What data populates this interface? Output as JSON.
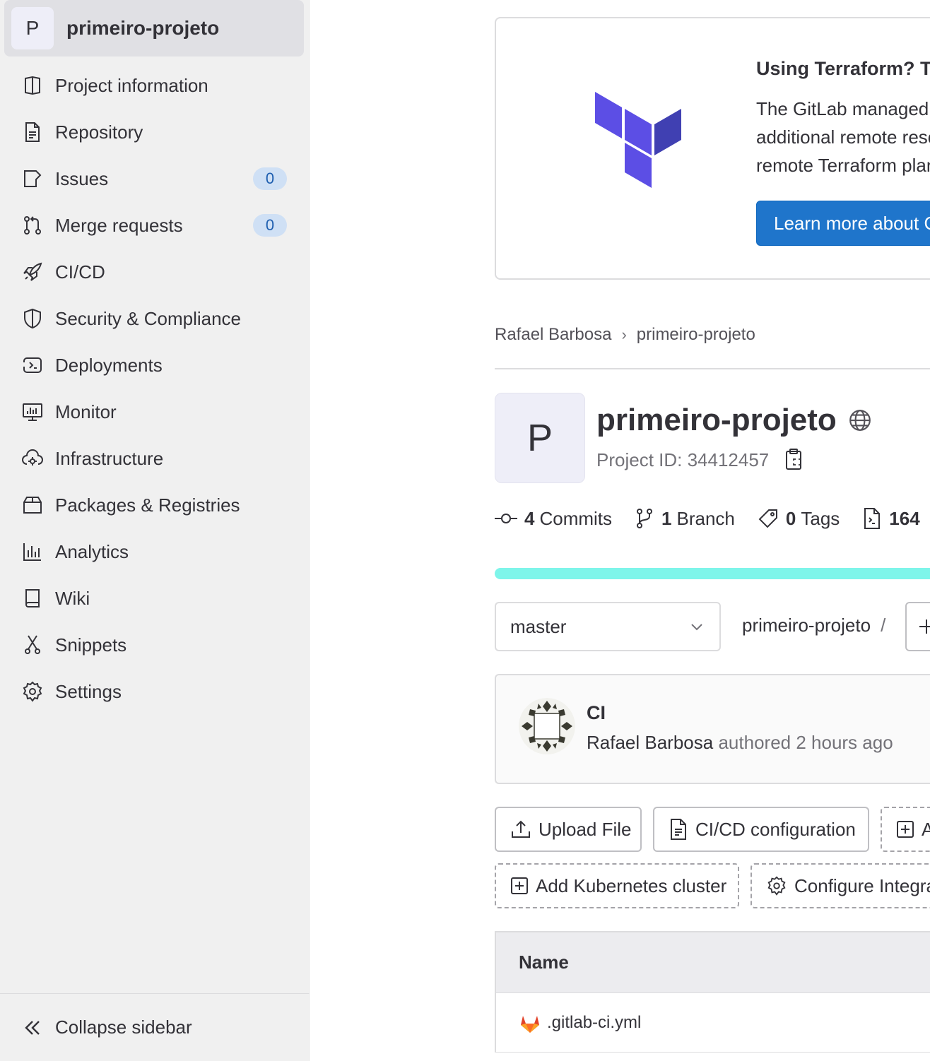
{
  "sidebar": {
    "project": {
      "avatar_letter": "P",
      "name": "primeiro-projeto"
    },
    "items": [
      {
        "label": "Project information",
        "icon": "project-icon"
      },
      {
        "label": "Repository",
        "icon": "doc-text-icon"
      },
      {
        "label": "Issues",
        "icon": "issues-icon",
        "badge": "0"
      },
      {
        "label": "Merge requests",
        "icon": "merge-request-icon",
        "badge": "0"
      },
      {
        "label": "CI/CD",
        "icon": "rocket-icon"
      },
      {
        "label": "Security & Compliance",
        "icon": "shield-icon"
      },
      {
        "label": "Deployments",
        "icon": "deployments-icon"
      },
      {
        "label": "Monitor",
        "icon": "monitor-icon"
      },
      {
        "label": "Infrastructure",
        "icon": "cloud-gear-icon"
      },
      {
        "label": "Packages & Registries",
        "icon": "package-icon"
      },
      {
        "label": "Analytics",
        "icon": "chart-icon"
      },
      {
        "label": "Wiki",
        "icon": "book-icon"
      },
      {
        "label": "Snippets",
        "icon": "scissors-icon"
      },
      {
        "label": "Settings",
        "icon": "settings-icon"
      }
    ],
    "collapse_label": "Collapse sidebar"
  },
  "terraform_banner": {
    "title": "Using Terraform? T",
    "body_lines": [
      "The GitLab managed",
      "additional remote reso",
      "remote Terraform plan"
    ],
    "button_label": "Learn more about G",
    "logo_color": "#5c4ee5"
  },
  "breadcrumb": {
    "items": [
      "Rafael Barbosa",
      "primeiro-projeto"
    ]
  },
  "project": {
    "avatar_letter": "P",
    "title": "primeiro-projeto",
    "visibility_icon": "globe-icon",
    "id_label": "Project ID: 34412457"
  },
  "stats": {
    "commits": {
      "count": "4",
      "label": "Commits"
    },
    "branches": {
      "count": "1",
      "label": "Branch"
    },
    "tags": {
      "count": "0",
      "label": "Tags"
    },
    "files": {
      "count": "164",
      "label": ""
    }
  },
  "repo": {
    "branch": "master",
    "path": "primeiro-projeto",
    "path_sep": "/"
  },
  "commit": {
    "title": "CI",
    "author": "Rafael Barbosa",
    "meta": "authored 2 hours ago"
  },
  "quick_actions": {
    "upload": "Upload File",
    "cicd": "CI/CD configuration",
    "add_partial": "A",
    "kubernetes": "Add Kubernetes cluster",
    "integrations": "Configure Integra"
  },
  "file_table": {
    "header": "Name",
    "rows": [
      {
        "name": ".gitlab-ci.yml",
        "icon": "gitlab-icon"
      }
    ]
  },
  "colors": {
    "accent": "#1f75cb",
    "progress": "#7ef5ea",
    "sidebar_bg": "#f0f0f0"
  }
}
